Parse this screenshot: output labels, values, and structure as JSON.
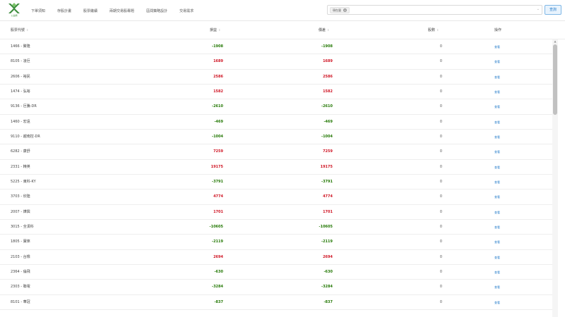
{
  "header": {
    "logo_text": "公益網",
    "nav": [
      "下單須知",
      "存股計畫",
      "股票繼續",
      "兩期交易股專題",
      "區間策略設計",
      "交易需求"
    ],
    "select": {
      "tag": "現在量",
      "tag_close": "×",
      "arrow": "⌄"
    },
    "query_button": "查詢"
  },
  "table": {
    "columns": {
      "name": "股票代號",
      "q1": "損益",
      "q2": "價差",
      "hold": "股數",
      "action": "操作"
    },
    "sort_icon": "⇕",
    "rows": [
      {
        "name": "1466 - 聚隆",
        "q1": "-1908",
        "q2": "-1908",
        "hold": "0",
        "action": "查看"
      },
      {
        "name": "8105 - 凌巨",
        "q1": "1689",
        "q2": "1689",
        "hold": "0",
        "action": "查看"
      },
      {
        "name": "2606 - 裕民",
        "q1": "2586",
        "q2": "2586",
        "hold": "0",
        "action": "查看"
      },
      {
        "name": "1474 - 弘裕",
        "q1": "1582",
        "q2": "1582",
        "hold": "0",
        "action": "查看"
      },
      {
        "name": "9136 - 巨騰-DR",
        "q1": "-2610",
        "q2": "-2610",
        "hold": "0",
        "action": "查看"
      },
      {
        "name": "1460 - 宏遠",
        "q1": "-469",
        "q2": "-469",
        "hold": "0",
        "action": "查看"
      },
      {
        "name": "9110 - 越南控-DR",
        "q1": "-1004",
        "q2": "-1004",
        "hold": "0",
        "action": "查看"
      },
      {
        "name": "6282 - 康舒",
        "q1": "7259",
        "q2": "7259",
        "hold": "0",
        "action": "查看"
      },
      {
        "name": "2331 - 精英",
        "q1": "19175",
        "q2": "19175",
        "hold": "0",
        "action": "查看"
      },
      {
        "name": "5225 - 東科-KY",
        "q1": "-3791",
        "q2": "-3791",
        "hold": "0",
        "action": "查看"
      },
      {
        "name": "3703 - 欣陸",
        "q1": "4774",
        "q2": "4774",
        "hold": "0",
        "action": "查看"
      },
      {
        "name": "2007 - 燁興",
        "q1": "1701",
        "q2": "1701",
        "hold": "0",
        "action": "查看"
      },
      {
        "name": "3015 - 全漢科",
        "q1": "-10605",
        "q2": "-10605",
        "hold": "0",
        "action": "查看"
      },
      {
        "name": "1805 - 寶徠",
        "q1": "-2119",
        "q2": "-2119",
        "hold": "0",
        "action": "查看"
      },
      {
        "name": "2103 - 台橡",
        "q1": "2694",
        "q2": "2694",
        "hold": "0",
        "action": "查看"
      },
      {
        "name": "2364 - 倫飛",
        "q1": "-630",
        "q2": "-630",
        "hold": "0",
        "action": "查看"
      },
      {
        "name": "2303 - 聯電",
        "q1": "-3284",
        "q2": "-3284",
        "hold": "0",
        "action": "查看"
      },
      {
        "name": "8101 - 華冠",
        "q1": "-837",
        "q2": "-837",
        "hold": "0",
        "action": "查看"
      }
    ]
  },
  "colors": {
    "positive": "#cf1322",
    "negative": "#237804",
    "accent": "#2a7fcb",
    "logo_green": "#3c8d3c"
  },
  "scrollbar": {
    "up_icon": "▲"
  }
}
